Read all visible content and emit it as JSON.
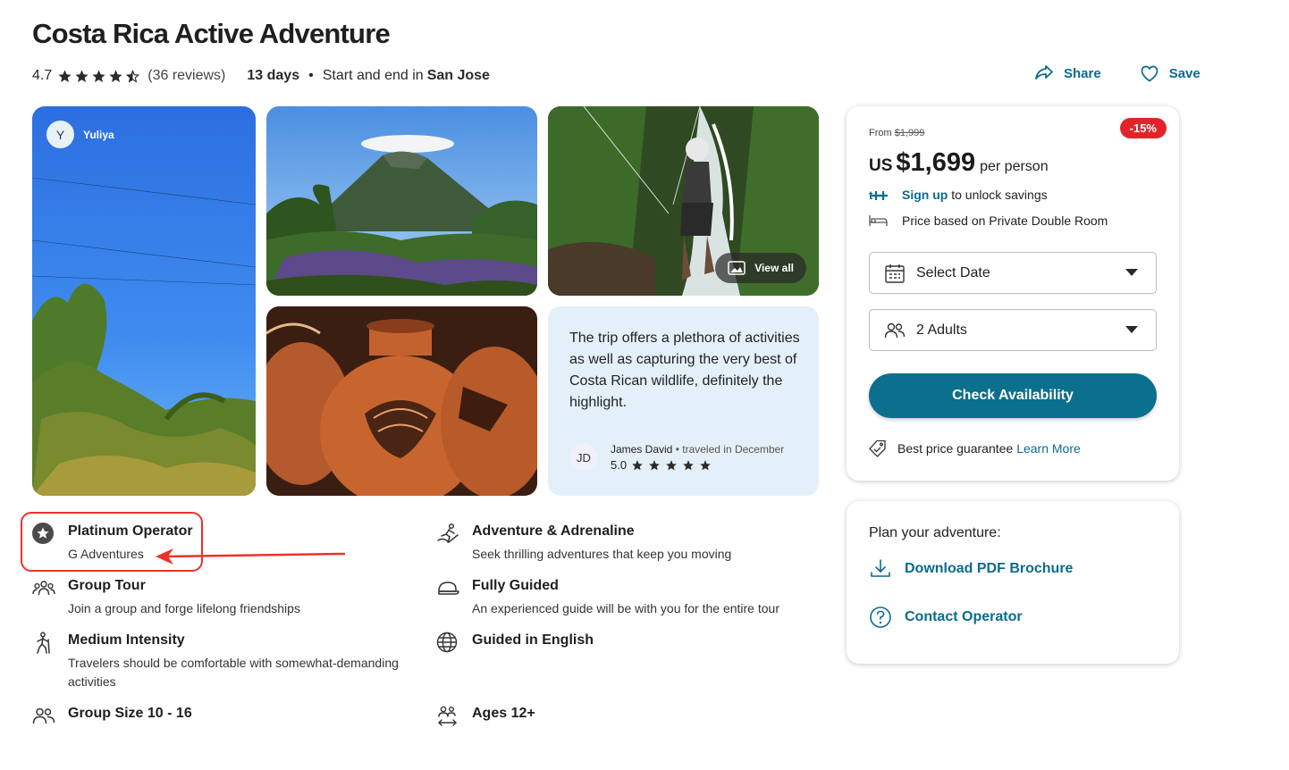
{
  "title": "Costa Rica Active Adventure",
  "meta": {
    "rating": "4.7",
    "stars": 4.5,
    "reviews": "(36 reviews)",
    "days": "13 days",
    "dot": "•",
    "start_end": "Start and end in",
    "city": "San Jose"
  },
  "actions": {
    "share": "Share",
    "save": "Save",
    "accent": "#0a6b8f"
  },
  "gallery": {
    "user_initial": "Y",
    "user_name": "Yuliya",
    "view_all": "View all",
    "icons": [
      "image-icon"
    ]
  },
  "quote": {
    "text": "The trip offers a plethora of activities as well as capturing the very best of Costa Rican wildlife, definitely the highlight.",
    "initials": "JD",
    "author": "James David",
    "traveled": "traveled in December",
    "rating": "5.0",
    "stars": 5
  },
  "features": [
    {
      "title": "Platinum Operator",
      "desc": "G Adventures",
      "icon": "platinum-star-icon"
    },
    {
      "title": "Adventure & Adrenaline",
      "desc": "Seek thrilling adventures that keep you moving",
      "icon": "adventure-icon"
    },
    {
      "title": "Group Tour",
      "desc": "Join a group and forge lifelong friendships",
      "icon": "group-icon"
    },
    {
      "title": "Fully Guided",
      "desc": "An experienced guide will be with you for the entire tour",
      "icon": "guide-cap-icon"
    },
    {
      "title": "Medium Intensity",
      "desc": "Travelers should be comfortable with somewhat-demanding activities",
      "icon": "hiker-icon"
    },
    {
      "title": "Guided in English",
      "desc": "",
      "icon": "globe-icon"
    },
    {
      "title": "Group Size 10 - 16",
      "desc": "",
      "icon": "people-icon"
    },
    {
      "title": "Ages 12+",
      "desc": "",
      "icon": "ages-icon"
    }
  ],
  "highlight_color": "#e8342a",
  "booking": {
    "from_label": "From",
    "old_price": "$1,999",
    "discount": "-15%",
    "currency": "US",
    "price": "$1,699",
    "per": "per person",
    "signup_link": "Sign up",
    "signup_rest": "to unlock savings",
    "room_note": "Price based on Private Double Room",
    "date_placeholder": "Select Date",
    "travelers": "2 Adults",
    "check_button": "Check Availability",
    "guarantee": "Best price guarantee",
    "learn_more": "Learn More",
    "button_color": "#0b6f8e",
    "discount_color": "#e0242a"
  },
  "plan": {
    "title": "Plan your adventure:",
    "download": "Download PDF Brochure",
    "contact": "Contact Operator"
  }
}
